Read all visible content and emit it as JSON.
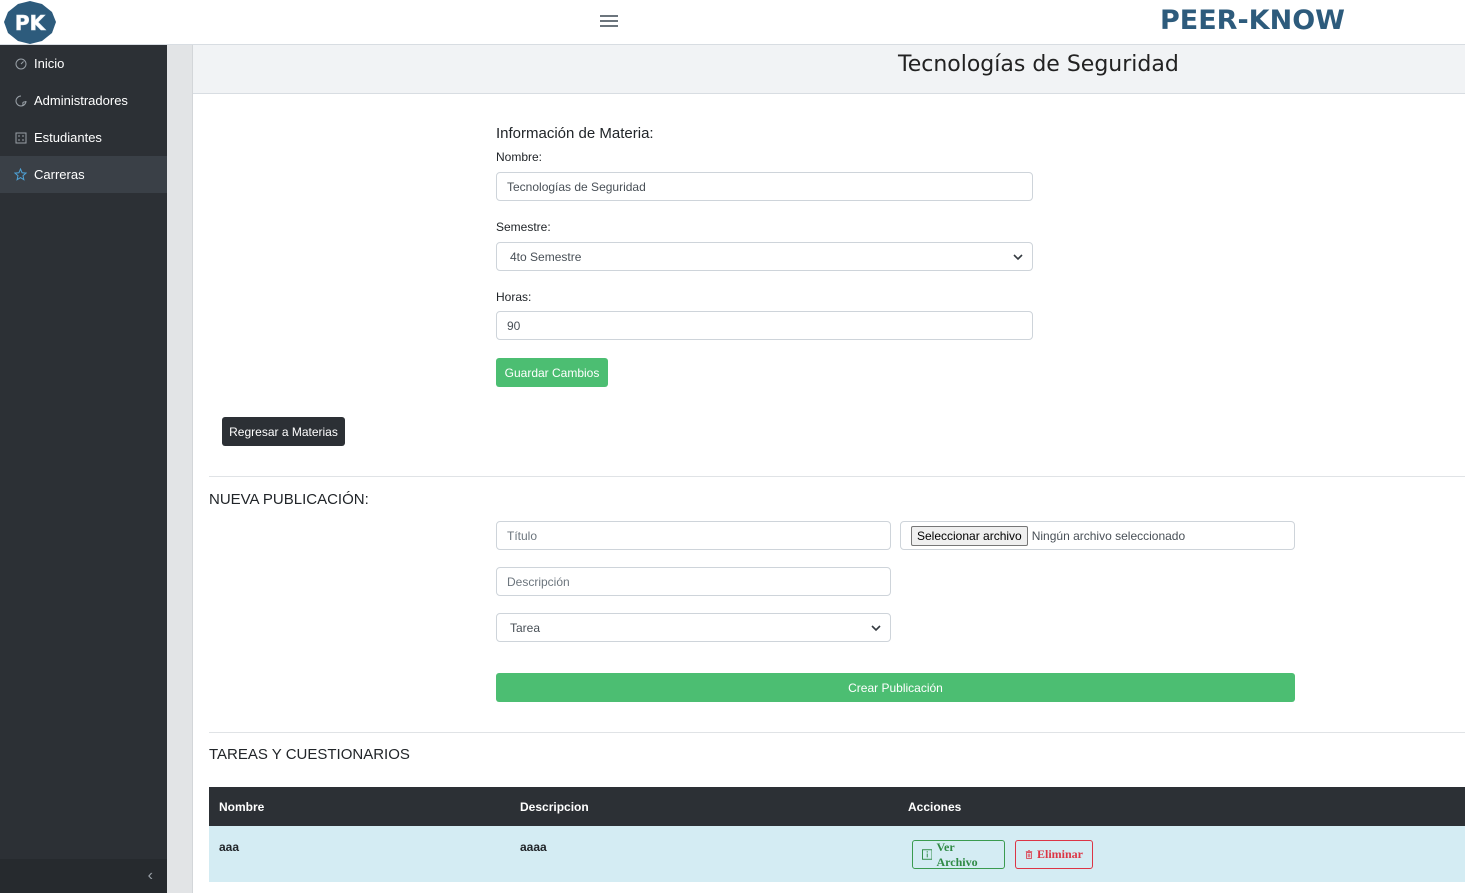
{
  "header": {
    "logo_text": "PK",
    "brand": "PEER-KNOW",
    "colors": {
      "brand": "#2d5b7c",
      "accent_green": "#4cbe72",
      "sidebar": "#2c3035"
    }
  },
  "sidebar": {
    "items": [
      {
        "label": "Inicio",
        "icon": "gauge-icon"
      },
      {
        "label": "Administradores",
        "icon": "palette-icon"
      },
      {
        "label": "Estudiantes",
        "icon": "calculator-icon"
      },
      {
        "label": "Carreras",
        "icon": "star-icon",
        "active": true
      }
    ]
  },
  "page": {
    "title": "Tecnologías de Seguridad"
  },
  "materia_form": {
    "heading": "Información de Materia:",
    "nombre_label": "Nombre:",
    "nombre_value": "Tecnologías de Seguridad",
    "semestre_label": "Semestre:",
    "semestre_value": "4to Semestre",
    "horas_label": "Horas:",
    "horas_value": "90",
    "save_label": "Guardar Cambios",
    "back_label": "Regresar a Materias"
  },
  "publicacion_form": {
    "heading": "NUEVA PUBLICACIÓN:",
    "titulo_placeholder": "Título",
    "descripcion_placeholder": "Descripción",
    "tipo_value": "Tarea",
    "file_button": "Seleccionar archivo",
    "file_status": "Ningún archivo seleccionado",
    "create_label": "Crear Publicación"
  },
  "tareas": {
    "heading": "TAREAS Y CUESTIONARIOS",
    "columns": [
      "Nombre",
      "Descripcion",
      "Acciones"
    ],
    "rows": [
      {
        "nombre": "aaa",
        "descripcion": "aaaa",
        "view_label": "Ver Archivo",
        "delete_label": "Eliminar"
      }
    ]
  }
}
